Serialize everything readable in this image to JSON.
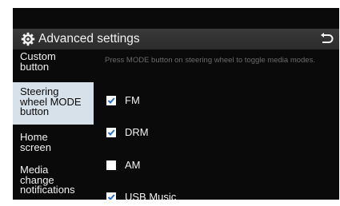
{
  "header": {
    "title": "Advanced settings",
    "settings_icon": "gear-icon",
    "back_icon": "back-arrow-icon"
  },
  "sidebar": {
    "items": [
      {
        "lines": [
          "Custom",
          "button"
        ],
        "active": false
      },
      {
        "lines": [
          "Steering",
          "wheel MODE",
          "button"
        ],
        "active": true
      },
      {
        "lines": [
          "Home",
          "screen"
        ],
        "active": false
      },
      {
        "lines": [
          "Media",
          "change",
          "notifications"
        ],
        "active": false
      }
    ]
  },
  "main": {
    "description": "Press MODE button on steering wheel to toggle media modes.",
    "options": [
      {
        "label": "FM",
        "checked": true
      },
      {
        "label": "DRM",
        "checked": true
      },
      {
        "label": "AM",
        "checked": false
      },
      {
        "label": "USB Music",
        "checked": true
      }
    ]
  },
  "colors": {
    "background": "#0a0a0a",
    "header": "#2f2f2f",
    "active_item": "#d6e1ea",
    "text": "#f0f0f0",
    "description_text": "#6a6a6a",
    "checkbox": "#ffffff",
    "checkmark": "#2b6fd6"
  }
}
